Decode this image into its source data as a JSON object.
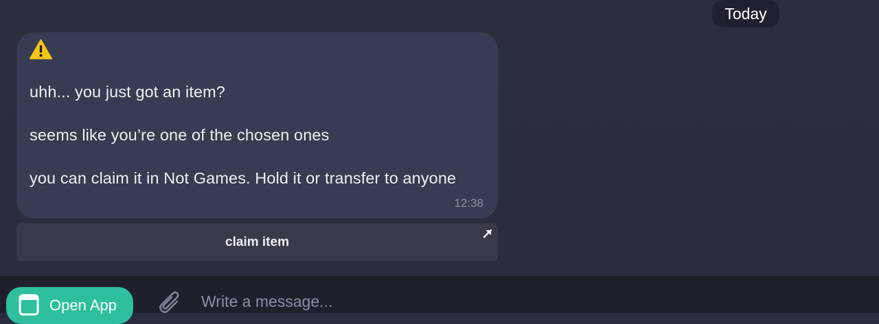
{
  "date_separator": "Today",
  "message": {
    "icon": "warning-icon",
    "lines": [
      "uhh... you just got an item?",
      "seems like you’re one of the chosen ones",
      "you can claim it in Not Games. Hold it or transfer to anyone"
    ],
    "time": "12:38"
  },
  "inline_button": {
    "label": "claim item",
    "icon": "external-link-arrow-icon"
  },
  "composer": {
    "open_app_label": "Open App",
    "open_app_icon": "app-window-icon",
    "attach_icon": "paperclip-icon",
    "placeholder": "Write a message..."
  },
  "colors": {
    "background": "#2a2d3b",
    "bubble": "#383c52",
    "button": "#383a48",
    "composer": "#1e202c",
    "accent": "#2ebf9c",
    "warning": "#f7c516"
  }
}
